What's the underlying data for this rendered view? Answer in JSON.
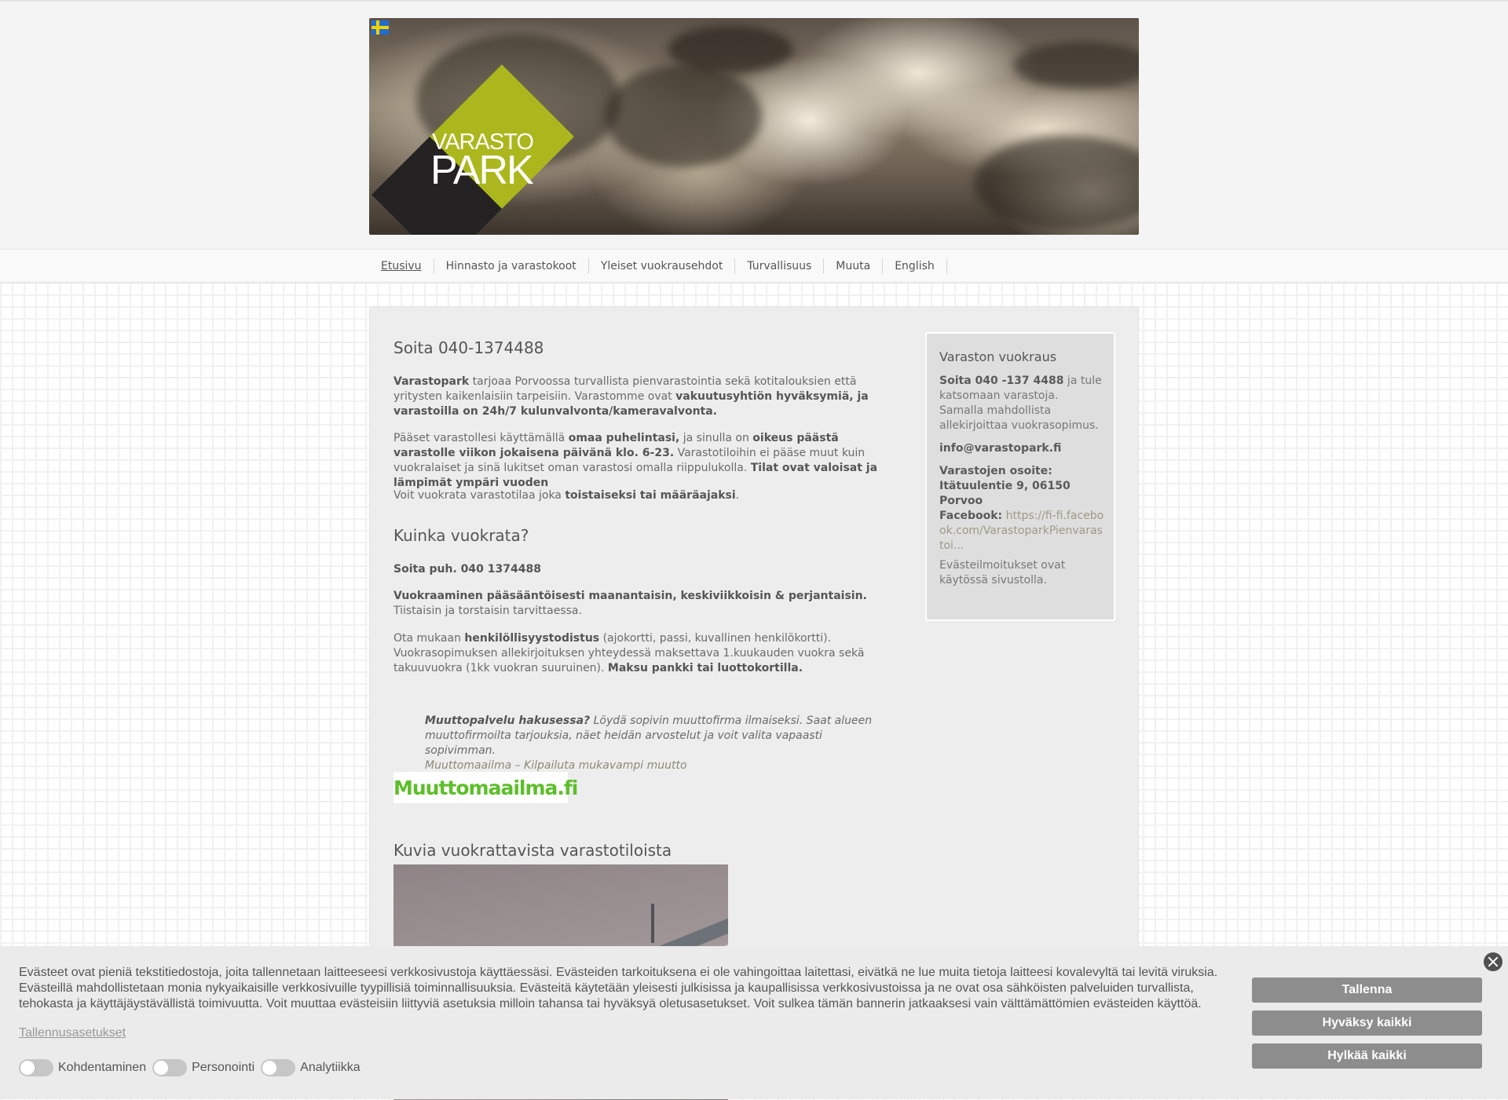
{
  "header": {
    "language_flag": "swedish-flag",
    "logo": {
      "line1": "VARASTO",
      "line2": "PARK"
    }
  },
  "nav": {
    "items": [
      {
        "label": "Etusivu",
        "active": true
      },
      {
        "label": "Hinnasto ja varastokoot",
        "active": false
      },
      {
        "label": "Yleiset vuokrausehdot",
        "active": false
      },
      {
        "label": "Turvallisuus",
        "active": false
      },
      {
        "label": "Muuta",
        "active": false
      },
      {
        "label": "English",
        "active": false
      }
    ]
  },
  "main": {
    "heading1": "Soita 040-1374488",
    "p1": {
      "b1": "Varastopark",
      "t1": " tarjoaa Porvoossa turvallista pienvarastointia sekä kotitalouksien että yritysten kaikenlaisiin tarpeisiin. Varastomme ovat ",
      "b2": "vakuutusyhtiön hyväksymiä, ja varastoilla on 24h/7 kulunvalvonta/kameravalvonta."
    },
    "p2": {
      "t1": "Pääset varastollesi käyttämällä ",
      "b1": "omaa puhelintasi,",
      "t2": " ja sinulla on ",
      "b2": "oikeus päästä varastolle viikon jokaisena päivänä klo. 6-23.",
      "t3": " Varastotiloihin ei pääse muut kuin vuokralaiset ja sinä lukitset oman varastosi omalla riippulukolla. ",
      "b3": "Tilat ovat valoisat ja lämpimät ympäri vuoden"
    },
    "p3": {
      "t1": "Voit vuokrata varastotilaa joka ",
      "b1": "toistaiseksi tai määräajaksi",
      "t2": "."
    },
    "heading2": "Kuinka vuokrata?",
    "p4": "Soita puh. 040 1374488",
    "p5": {
      "b1": "Vuokraaminen pääsääntöisesti maanantaisin, keskiviikkoisin & perjantaisin.",
      "t1": " Tiistaisin ja torstaisin tarvittaessa."
    },
    "p6": {
      "t1": "Ota mukaan ",
      "b1": "henkilöllisyystodistus",
      "t2": " (ajokortti, passi, kuvallinen henkilökortti). Vuokrasopimuksen allekirjoituksen yhteydessä maksettava 1.kuukauden vuokra sekä takuuvuokra (1kk vuokran suuruinen). ",
      "b2": "Maksu pankki tai luottokortilla."
    },
    "quote": {
      "b1": "Muuttopalvelu hakusessa?",
      "t1": " Löydä sopivin muuttofirma ilmaiseksi. Saat alueen muuttofirmoilta tarjouksia, näet heidän arvostelut ja voit valita vapaasti sopivimman.",
      "link": "Muuttomaailma – Kilpailuta mukavampi muutto"
    },
    "partner_logo": "Muuttomaailma.fi",
    "heading3": "Kuvia vuokrattavista varastotiloista"
  },
  "sidebar": {
    "title": "Varaston vuokraus",
    "p1": {
      "b1": "Soita 040 -137 4488",
      "t1": " ja tule katsomaan varastoja. Samalla mahdollista allekirjoittaa vuokrasopimus."
    },
    "email": "info@varastopark.fi",
    "address": "Varastojen osoite: Itätuulentie 9, 06150 Porvoo",
    "facebook_label": "Facebook:",
    "facebook_link": "https://fi-fi.facebook.com/VarastoparkPienvarastoi...",
    "cookie_note": "Evästeilmoitukset ovat käytössä sivustolla."
  },
  "cookie_banner": {
    "text": "Evästeet ovat pieniä tekstitiedostoja, joita tallennetaan laitteeseesi verkkosivustoja käyttäessäsi. Evästeiden tarkoituksena ei ole vahingoittaa laitettasi, eivätkä ne lue muita tietoja laitteesi kovalevyltä tai levitä viruksia. Evästeillä mahdollistetaan monia nykyaikaisille verkkosivuille tyypillisiä toiminnallisuuksia. Evästeitä käytetään yleisesti julkisissa ja kaupallisissa verkkosivustoissa ja ne ovat osa sähköisten palveluiden turvallista, tehokasta ja käyttäjäystävällistä toimivuutta. Voit muuttaa evästeisiin liittyviä asetuksia milloin tahansa tai hyväksyä oletusasetukset. Voit sulkea tämän bannerin jatkaaksesi vain välttämättömien evästeiden käyttöä.",
    "settings_link": "Tallennusasetukset",
    "toggles": [
      {
        "label": "Kohdentaminen",
        "on": false
      },
      {
        "label": "Personointi",
        "on": false
      },
      {
        "label": "Analytiikka",
        "on": false
      }
    ],
    "buttons": {
      "save": "Tallenna",
      "accept_all": "Hyväksy kaikki",
      "reject_all": "Hylkää kaikki"
    }
  }
}
